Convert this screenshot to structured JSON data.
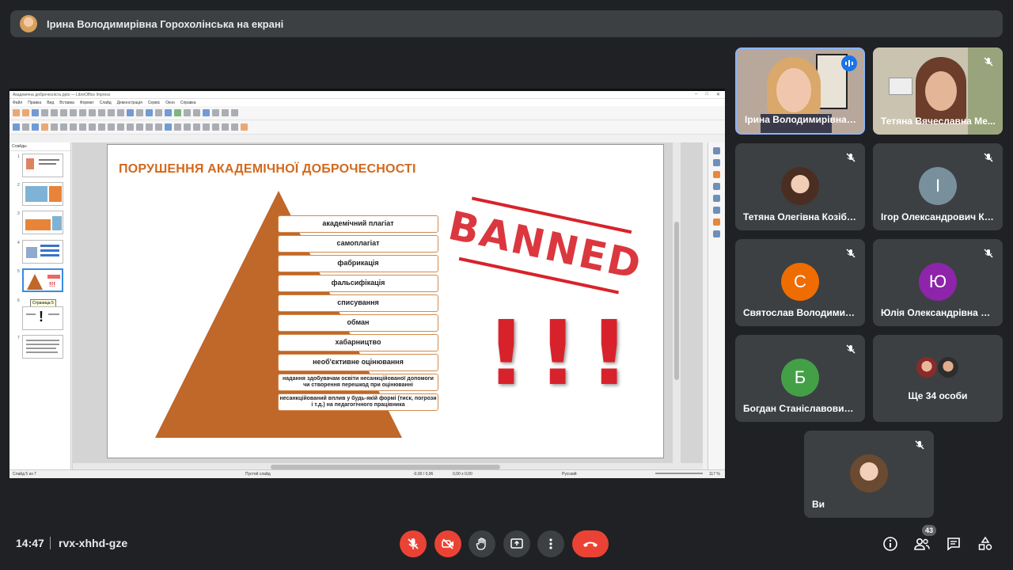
{
  "presenter_bar": {
    "title": "Ірина Володимирівна Горохолінська на екрані"
  },
  "app": {
    "window_title": "Академічна доброчесність.pptx — LibreOffice Impress",
    "menu": [
      "Файл",
      "Правка",
      "Вид",
      "Вставка",
      "Формат",
      "Слайд",
      "Демонстрація",
      "Сервіс",
      "Окно",
      "Справка"
    ],
    "panel_title": "Слайды",
    "tooltip": "Страница 5",
    "status": {
      "slide": "Слайд 5 из 7",
      "layout": "Пустой слайд",
      "pos": "-0,00 / 0,96",
      "size": "0,00 x 0,00",
      "lang": "Русский",
      "zoom": "117 %"
    },
    "thumb_numbers": [
      "1",
      "2",
      "3",
      "4",
      "5",
      "6",
      "7"
    ]
  },
  "slide": {
    "title": "ПОРУШЕННЯ АКАДЕМІЧНОЇ ДОБРОЧЕСНОСТІ",
    "levels": [
      "академічний плагіат",
      "самоплагіат",
      "фабрикація",
      "фальсифікація",
      "списування",
      "обман",
      "хабарництво",
      "необ'єктивне оцінювання",
      "надання здобувачам освіти несанкційованої допомоги чи створення перешкод при оцінюванні",
      "несанкційований вплив у будь-якій формі (тиск, погрози і т.д.) на педагогічного працівника"
    ],
    "stamp_text": "BANNED",
    "exclaim": "!!!",
    "colors": {
      "accent": "#d2691e",
      "pyramid": "#c0672a",
      "stamp": "#d8222b"
    }
  },
  "participants": [
    {
      "name": "Ірина Володимирівна ...",
      "type": "video",
      "speaking": true
    },
    {
      "name": "Тетяна Вячеславна Ме...",
      "type": "video"
    },
    {
      "name": "Тетяна Олегівна Козібр...",
      "type": "photo"
    },
    {
      "name": "Ігор Олександрович Ко...",
      "initial": "І",
      "color": "#78909c"
    },
    {
      "name": "Святослав Володимир...",
      "initial": "С",
      "color": "#ef6c00"
    },
    {
      "name": "Юлія Олександрівна Ш...",
      "initial": "Ю",
      "color": "#8e24aa"
    },
    {
      "name": "Богдан Станіславович ...",
      "initial": "Б",
      "color": "#43a047"
    },
    {
      "name": "Ще 34 особи",
      "type": "more"
    },
    {
      "name": "Ви",
      "type": "photo"
    }
  ],
  "bottom": {
    "time": "14:47",
    "code": "rvx-xhhd-gze",
    "people_count": "43"
  }
}
